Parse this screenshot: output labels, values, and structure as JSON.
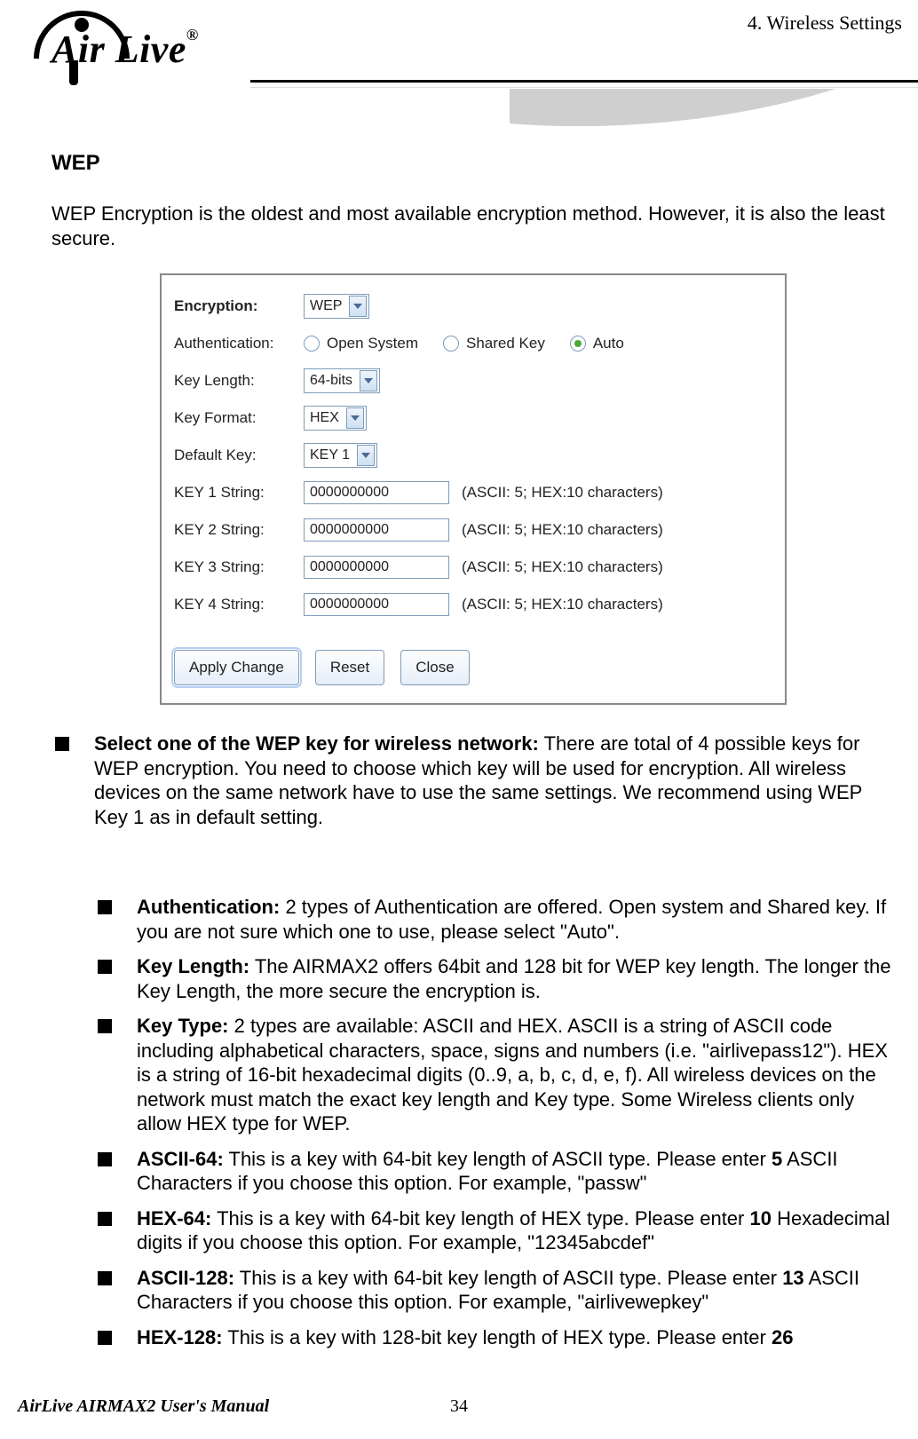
{
  "header": {
    "brand": "Air Live",
    "registered": "®",
    "chapter": "4.  Wireless  Settings"
  },
  "section": {
    "title": "WEP",
    "intro": "WEP Encryption is the oldest and most available encryption method.    However, it is also the least secure."
  },
  "panel": {
    "encryption": {
      "label": "Encryption:",
      "value": "WEP"
    },
    "auth": {
      "label": "Authentication:",
      "options": [
        "Open System",
        "Shared Key",
        "Auto"
      ],
      "selected": "Auto"
    },
    "keyLength": {
      "label": "Key Length:",
      "value": "64-bits"
    },
    "keyFormat": {
      "label": "Key Format:",
      "value": "HEX"
    },
    "defaultKey": {
      "label": "Default Key:",
      "value": "KEY 1"
    },
    "keyHint": "(ASCII: 5; HEX:10 characters)",
    "keys": [
      {
        "label": "KEY 1 String:",
        "value": "0000000000"
      },
      {
        "label": "KEY 2 String:",
        "value": "0000000000"
      },
      {
        "label": "KEY 3 String:",
        "value": "0000000000"
      },
      {
        "label": "KEY 4 String:",
        "value": "0000000000"
      }
    ],
    "buttons": {
      "apply": "Apply Change",
      "reset": "Reset",
      "close": "Close"
    }
  },
  "bullets": {
    "selectKey": {
      "bold": "Select one of the WEP key for wireless network:",
      "text": "    There are total of 4 possible keys for WEP encryption.    You need to choose which key will be used for encryption.    All wireless devices on the same network have to use the same settings.    We recommend using WEP Key 1 as in default setting."
    },
    "items": [
      {
        "bold": "Authentication:",
        "text": "    2 types of Authentication are offered.    Open system and Shared key.    If you are not sure which one to use, please select \"Auto\"."
      },
      {
        "bold": "Key Length:",
        "text": "    The AIRMAX2 offers 64bit and 128 bit for WEP key length.    The longer the Key Length, the more secure the encryption is."
      },
      {
        "bold": "Key Type:",
        "text": "    2 types are available: ASCII and HEX.    ASCII is a string of ASCII code including alphabetical characters, space, signs and numbers (i.e. \"airlivepass12\").    HEX is a string of 16-bit hexadecimal digits (0..9, a, b, c, d, e, f).   All wireless devices on the network must match the exact key length and Key type.   Some Wireless clients only allow HEX type for WEP."
      },
      {
        "bold": "ASCII-64:",
        "text_pre": " This is a key with 64-bit key length of ASCII type.    Please enter ",
        "num": "5",
        "text_post": " ASCII Characters if you choose this option. For example, \"passw\""
      },
      {
        "bold": "HEX-64:",
        "text_pre": " This is a key with 64-bit key length of HEX type.    Please enter ",
        "num": "10",
        "text_post": " Hexadecimal digits if you choose this option. For example, \"12345abcdef\""
      },
      {
        "bold": "ASCII-128:",
        "text_pre": " This is a key with 64-bit key length of ASCII type.    Please enter ",
        "num": "13",
        "text_post": " ASCII Characters if you choose this option. For example, \"airlivewepkey\""
      },
      {
        "bold": "HEX-128:",
        "text_pre": " This is a key with 128-bit key length of HEX type.    Please enter ",
        "num": "26",
        "text_post": ""
      }
    ]
  },
  "footer": {
    "manual": "AirLive AIRMAX2 User's Manual",
    "page": "34"
  }
}
